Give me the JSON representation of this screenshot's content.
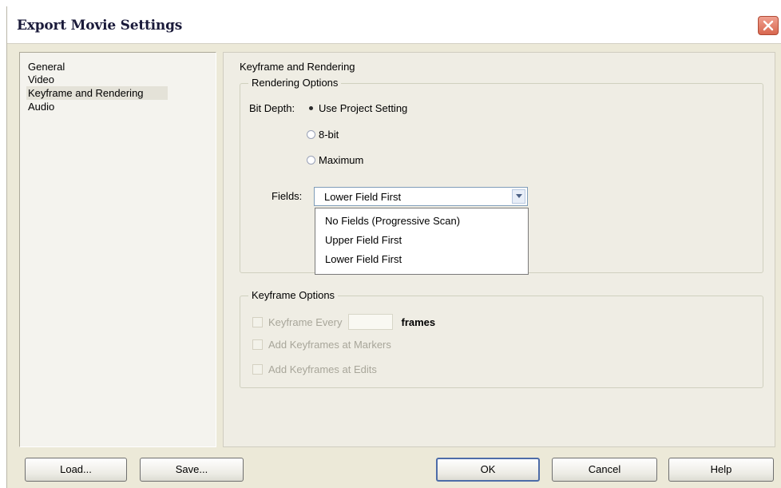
{
  "window": {
    "title": "Export Movie Settings"
  },
  "nav": {
    "items": [
      {
        "label": "General"
      },
      {
        "label": "Video"
      },
      {
        "label": "Keyframe and Rendering"
      },
      {
        "label": "Audio"
      }
    ],
    "selected": "Keyframe and Rendering"
  },
  "panel": {
    "title": "Keyframe and Rendering",
    "rendering": {
      "group_label": "Rendering Options",
      "bit_depth_label": "Bit Depth:",
      "bit_depth_options": [
        "Use Project Setting",
        "8-bit",
        "Maximum"
      ],
      "bit_depth_selected": "Use Project Setting",
      "fields_label": "Fields:",
      "fields_value": "Lower Field First",
      "fields_options": [
        "No Fields (Progressive Scan)",
        "Upper Field First",
        "Lower Field First"
      ]
    },
    "keyframe": {
      "group_label": "Keyframe Options",
      "every_label": "Keyframe Every",
      "every_value": "",
      "frames_label": "frames",
      "add_at_markers_label": "Add Keyframes at Markers",
      "add_at_edits_label": "Add Keyframes at Edits"
    }
  },
  "buttons": {
    "load": "Load...",
    "save": "Save...",
    "ok": "OK",
    "cancel": "Cancel",
    "help": "Help"
  },
  "colors": {
    "dialog_bg": "#ece9d8",
    "default_button_border": "#4d6ca8",
    "close_button": "#d8674f"
  }
}
